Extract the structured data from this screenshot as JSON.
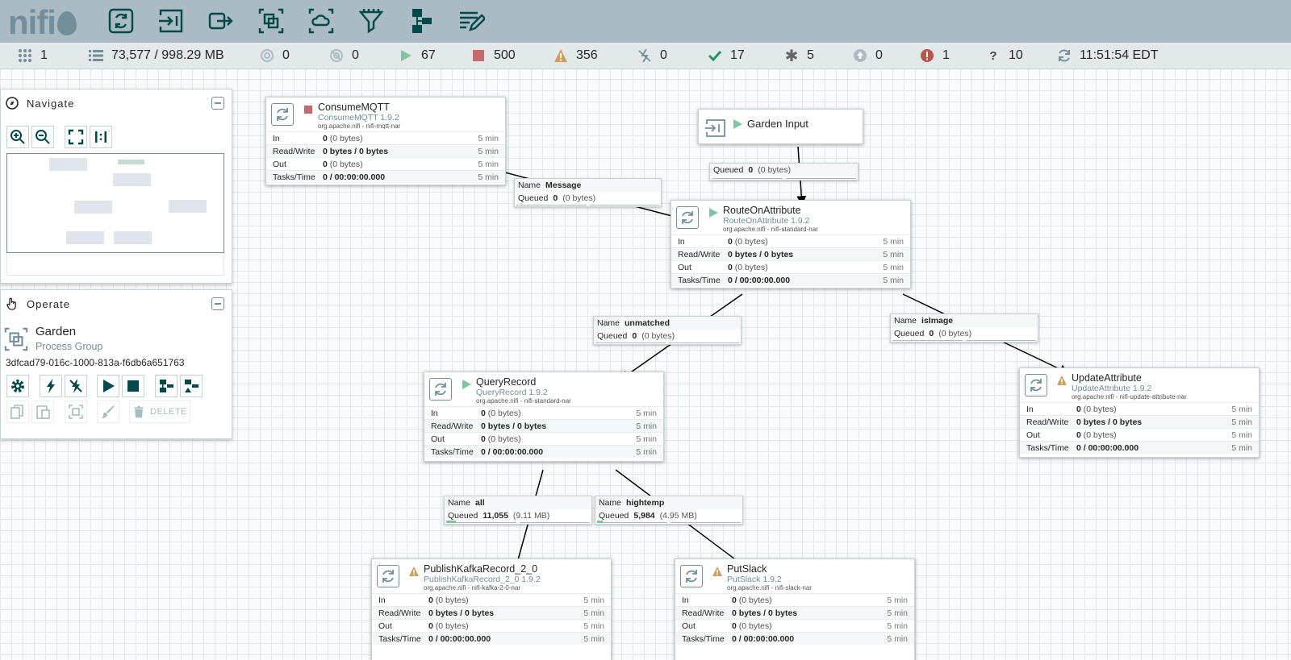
{
  "header": {
    "logo_text": "nifi",
    "tools": [
      "processor-icon",
      "input-port-icon",
      "output-port-icon",
      "process-group-icon",
      "remote-process-group-icon",
      "funnel-icon",
      "template-icon",
      "label-icon"
    ]
  },
  "status": {
    "cluster": "1",
    "queued": "73,577 / 998.29 MB",
    "transmitting": "0",
    "not_transmitting": "0",
    "running": "67",
    "stopped": "500",
    "invalid": "356",
    "disabled": "0",
    "up_to_date": "17",
    "locally_modified": "5",
    "stale": "0",
    "sync_failure": "1",
    "unknown": "10",
    "last_refresh": "11:51:54 EDT"
  },
  "navigate": {
    "title": "Navigate"
  },
  "operate": {
    "title": "Operate",
    "name": "Garden",
    "type": "Process Group",
    "id": "3dfcad79-016c-1000-813a-f6db6a651763",
    "delete_label": "DELETE"
  },
  "labels": {
    "in": "In",
    "rw": "Read/Write",
    "out": "Out",
    "tasks": "Tasks/Time",
    "name": "Name",
    "queued": "Queued"
  },
  "processors": [
    {
      "name": "ConsumeMQTT",
      "type": "ConsumeMQTT 1.9.2",
      "bundle": "org.apache.nifi - nifi-mqtt-nar",
      "state": "stopped",
      "in_b": "0",
      "in_r": " (0 bytes)",
      "rw": "0 bytes / 0 bytes",
      "out_b": "0",
      "out_r": " (0 bytes)",
      "tasks": "0 / 00:00:00.000",
      "window": "5 min"
    },
    {
      "name": "RouteOnAttribute",
      "type": "RouteOnAttribute 1.9.2",
      "bundle": "org.apache.nifi - nifi-standard-nar",
      "state": "running",
      "in_b": "0",
      "in_r": " (0 bytes)",
      "rw": "0 bytes / 0 bytes",
      "out_b": "0",
      "out_r": " (0 bytes)",
      "tasks": "0 / 00:00:00.000",
      "window": "5 min"
    },
    {
      "name": "QueryRecord",
      "type": "QueryRecord 1.9.2",
      "bundle": "org.apache.nifi - nifi-standard-nar",
      "state": "running",
      "in_b": "0",
      "in_r": " (0 bytes)",
      "rw": "0 bytes / 0 bytes",
      "out_b": "0",
      "out_r": " (0 bytes)",
      "tasks": "0 / 00:00:00.000",
      "window": "5 min"
    },
    {
      "name": "UpdateAttribute",
      "type": "UpdateAttribute 1.9.2",
      "bundle": "org.apache.nifi - nifi-update-attribute-nar",
      "state": "invalid",
      "in_b": "0",
      "in_r": " (0 bytes)",
      "rw": "0 bytes / 0 bytes",
      "out_b": "0",
      "out_r": " (0 bytes)",
      "tasks": "0 / 00:00:00.000",
      "window": "5 min"
    },
    {
      "name": "PublishKafkaRecord_2_0",
      "type": "PublishKafkaRecord_2_0 1.9.2",
      "bundle": "org.apache.nifi - nifi-kafka-2-0-nar",
      "state": "invalid",
      "in_b": "0",
      "in_r": " (0 bytes)",
      "rw": "0 bytes / 0 bytes",
      "out_b": "0",
      "out_r": " (0 bytes)",
      "tasks": "0 / 00:00:00.000",
      "window": "5 min"
    },
    {
      "name": "PutSlack",
      "type": "PutSlack 1.9.2",
      "bundle": "org.apache.nifi - nifi-slack-nar",
      "state": "invalid",
      "in_b": "0",
      "in_r": " (0 bytes)",
      "rw": "0 bytes / 0 bytes",
      "out_b": "0",
      "out_r": " (0 bytes)",
      "tasks": "0 / 00:00:00.000",
      "window": "5 min"
    }
  ],
  "input_port": {
    "name": "Garden Input"
  },
  "connections": [
    {
      "name": "",
      "queued_count": "0",
      "queued_size": "(0 bytes)"
    },
    {
      "name": "Message",
      "queued_count": "0",
      "queued_size": "(0 bytes)"
    },
    {
      "name": "unmatched",
      "queued_count": "0",
      "queued_size": "(0 bytes)"
    },
    {
      "name": "isImage",
      "queued_count": "0",
      "queued_size": "(0 bytes)"
    },
    {
      "name": "all",
      "queued_count": "11,055",
      "queued_size": "(9.11 MB)"
    },
    {
      "name": "hightemp",
      "queued_count": "5,984",
      "queued_size": "(4.95 MB)"
    }
  ]
}
